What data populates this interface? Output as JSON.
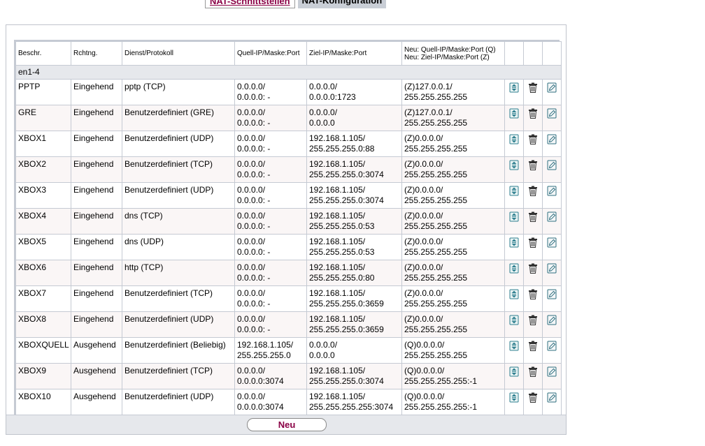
{
  "tabs": {
    "interfaces": "NAT-Schnittstellen",
    "config": "NAT-Konfiguration"
  },
  "table": {
    "headers": {
      "desc": "Beschr.",
      "dir": "Rchtng.",
      "service": "Dienst/Protokoll",
      "source": "Quell-IP/Maske:Port",
      "dest": "Ziel-IP/Maske:Port",
      "new_line1": "Neu: Quell-IP/Maske:Port (Q)",
      "new_line2": "Neu: Ziel-IP/Maske:Port (Z)"
    },
    "group": "en1-4",
    "rows": [
      {
        "desc": "PPTP",
        "dir": "Eingehend",
        "service": "pptp (TCP)",
        "src1": "0.0.0.0/",
        "src2": "0.0.0.0: -",
        "dst1": "0.0.0.0/",
        "dst2": "0.0.0.0:1723",
        "new1": "(Z)127.0.0.1/",
        "new2": "255.255.255.255"
      },
      {
        "desc": "GRE",
        "dir": "Eingehend",
        "service": "Benutzerdefiniert (GRE)",
        "src1": "0.0.0.0/",
        "src2": "0.0.0.0: -",
        "dst1": "0.0.0.0/",
        "dst2": "0.0.0.0",
        "new1": "(Z)127.0.0.1/",
        "new2": "255.255.255.255"
      },
      {
        "desc": "XBOX1",
        "dir": "Eingehend",
        "service": "Benutzerdefiniert (UDP)",
        "src1": "0.0.0.0/",
        "src2": "0.0.0.0: -",
        "dst1": "192.168.1.105/",
        "dst2": "255.255.255.0:88",
        "new1": "(Z)0.0.0.0/",
        "new2": "255.255.255.255"
      },
      {
        "desc": "XBOX2",
        "dir": "Eingehend",
        "service": "Benutzerdefiniert (TCP)",
        "src1": "0.0.0.0/",
        "src2": "0.0.0.0: -",
        "dst1": "192.168.1.105/",
        "dst2": "255.255.255.0:3074",
        "new1": "(Z)0.0.0.0/",
        "new2": "255.255.255.255"
      },
      {
        "desc": "XBOX3",
        "dir": "Eingehend",
        "service": "Benutzerdefiniert (UDP)",
        "src1": "0.0.0.0/",
        "src2": "0.0.0.0: -",
        "dst1": "192.168.1.105/",
        "dst2": "255.255.255.0:3074",
        "new1": "(Z)0.0.0.0/",
        "new2": "255.255.255.255"
      },
      {
        "desc": "XBOX4",
        "dir": "Eingehend",
        "service": "dns (TCP)",
        "src1": "0.0.0.0/",
        "src2": "0.0.0.0: -",
        "dst1": "192.168.1.105/",
        "dst2": "255.255.255.0:53",
        "new1": "(Z)0.0.0.0/",
        "new2": "255.255.255.255"
      },
      {
        "desc": "XBOX5",
        "dir": "Eingehend",
        "service": "dns (UDP)",
        "src1": "0.0.0.0/",
        "src2": "0.0.0.0: -",
        "dst1": "192.168.1.105/",
        "dst2": "255.255.255.0:53",
        "new1": "(Z)0.0.0.0/",
        "new2": "255.255.255.255"
      },
      {
        "desc": "XBOX6",
        "dir": "Eingehend",
        "service": "http (TCP)",
        "src1": "0.0.0.0/",
        "src2": "0.0.0.0: -",
        "dst1": "192.168.1.105/",
        "dst2": "255.255.255.0:80",
        "new1": "(Z)0.0.0.0/",
        "new2": "255.255.255.255"
      },
      {
        "desc": "XBOX7",
        "dir": "Eingehend",
        "service": "Benutzerdefiniert (TCP)",
        "src1": "0.0.0.0/",
        "src2": "0.0.0.0: -",
        "dst1": "192.168.1.105/",
        "dst2": "255.255.255.0:3659",
        "new1": "(Z)0.0.0.0/",
        "new2": "255.255.255.255"
      },
      {
        "desc": "XBOX8",
        "dir": "Eingehend",
        "service": "Benutzerdefiniert (UDP)",
        "src1": "0.0.0.0/",
        "src2": "0.0.0.0: -",
        "dst1": "192.168.1.105/",
        "dst2": "255.255.255.0:3659",
        "new1": "(Z)0.0.0.0/",
        "new2": "255.255.255.255"
      },
      {
        "desc": "XBOXQUELL",
        "dir": "Ausgehend",
        "service": "Benutzerdefiniert (Beliebig)",
        "src1": "192.168.1.105/",
        "src2": "255.255.255.0",
        "dst1": "0.0.0.0/",
        "dst2": "0.0.0.0",
        "new1": "(Q)0.0.0.0/",
        "new2": "255.255.255.255"
      },
      {
        "desc": "XBOX9",
        "dir": "Ausgehend",
        "service": "Benutzerdefiniert (TCP)",
        "src1": "0.0.0.0/",
        "src2": "0.0.0.0:3074",
        "dst1": "192.168.1.105/",
        "dst2": "255.255.255.0:3074",
        "new1": "(Q)0.0.0.0/",
        "new2": "255.255.255.255:-1"
      },
      {
        "desc": "XBOX10",
        "dir": "Ausgehend",
        "service": "Benutzerdefiniert (UDP)",
        "src1": "0.0.0.0/",
        "src2": "0.0.0.0:3074",
        "dst1": "192.168.1.105/",
        "dst2": "255.255.255.255:3074",
        "new1": "(Q)0.0.0.0/",
        "new2": "255.255.255.255:-1"
      }
    ]
  },
  "actions": {
    "new_label": "Neu"
  },
  "icons": {
    "move": "move-up-down-icon",
    "delete": "trash-icon",
    "edit": "edit-pencil-icon"
  },
  "colors": {
    "accent": "#8a0045",
    "header_bg": "#e6e8ec",
    "border": "#c5cad3"
  }
}
